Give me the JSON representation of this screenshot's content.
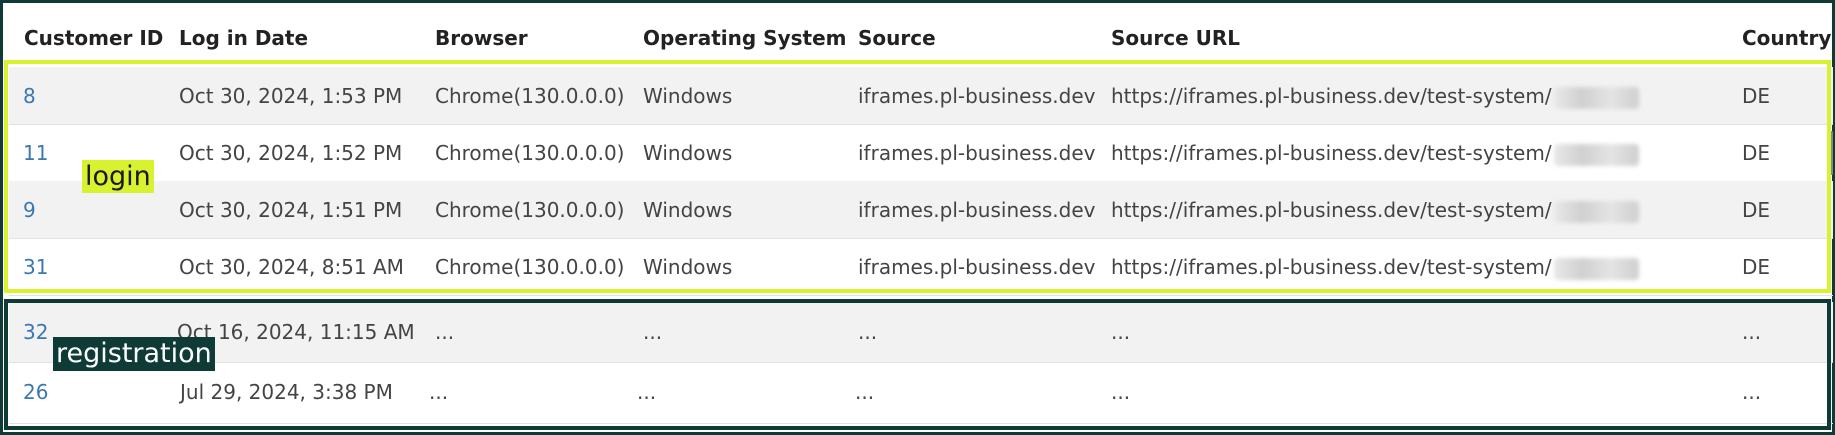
{
  "columns": {
    "customer_id": "Customer ID",
    "login_date": "Log in Date",
    "browser": "Browser",
    "os": "Operating System",
    "source": "Source",
    "source_url": "Source URL",
    "country": "Country"
  },
  "login_rows": [
    {
      "id": "8",
      "date": "Oct 30, 2024, 1:53 PM",
      "browser": "Chrome(130.0.0.0)",
      "os": "Windows",
      "source": "iframes.pl-business.dev",
      "url": "https://iframes.pl-business.dev/test-system/",
      "country": "DE"
    },
    {
      "id": "11",
      "date": "Oct 30, 2024, 1:52 PM",
      "browser": "Chrome(130.0.0.0)",
      "os": "Windows",
      "source": "iframes.pl-business.dev",
      "url": "https://iframes.pl-business.dev/test-system/",
      "country": "DE"
    },
    {
      "id": "9",
      "date": "Oct 30, 2024, 1:51 PM",
      "browser": "Chrome(130.0.0.0)",
      "os": "Windows",
      "source": "iframes.pl-business.dev",
      "url": "https://iframes.pl-business.dev/test-system/",
      "country": "DE"
    },
    {
      "id": "31",
      "date": "Oct 30, 2024, 8:51 AM",
      "browser": "Chrome(130.0.0.0)",
      "os": "Windows",
      "source": "iframes.pl-business.dev",
      "url": "https://iframes.pl-business.dev/test-system/",
      "country": "DE"
    }
  ],
  "registration_rows": [
    {
      "id": "32",
      "date": "Oct 16, 2024, 11:15 AM",
      "browser": "...",
      "os": "...",
      "source": "...",
      "url": "...",
      "country": "..."
    },
    {
      "id": "26",
      "date": "Jul 29, 2024, 3:38 PM",
      "browser": "...",
      "os": "...",
      "source": "...",
      "url": "...",
      "country": "..."
    }
  ],
  "annotations": {
    "login": "login",
    "registration": "registration"
  },
  "colors": {
    "login_highlight": "#d8f22f",
    "registration_highlight": "#0e3b36",
    "link": "#3a78b0"
  }
}
